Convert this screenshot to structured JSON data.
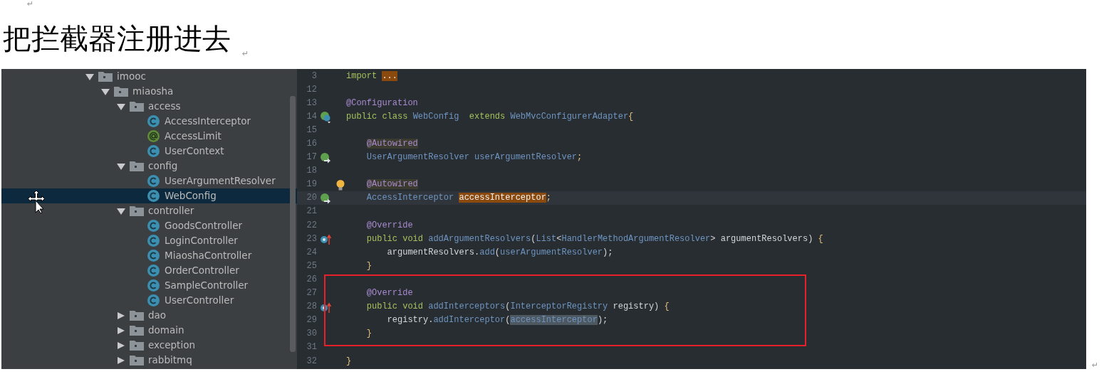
{
  "top_mark": "↵",
  "heading": {
    "text": "把拦截器注册进去",
    "mark": "↵"
  },
  "screenshot": {
    "project_tree": [
      {
        "label": "imooc",
        "kind": "folder",
        "expanded": true,
        "selected": false,
        "children": [
          {
            "label": "miaosha",
            "kind": "folder",
            "expanded": true,
            "selected": false,
            "children": [
              {
                "label": "access",
                "kind": "folder",
                "expanded": true,
                "selected": false,
                "children": [
                  {
                    "label": "AccessInterceptor",
                    "kind": "class",
                    "selected": false
                  },
                  {
                    "label": "AccessLimit",
                    "kind": "annotation",
                    "selected": false
                  },
                  {
                    "label": "UserContext",
                    "kind": "class",
                    "selected": false
                  }
                ]
              },
              {
                "label": "config",
                "kind": "folder",
                "expanded": true,
                "selected": false,
                "children": [
                  {
                    "label": "UserArgumentResolver",
                    "kind": "class",
                    "selected": false
                  },
                  {
                    "label": "WebConfig",
                    "kind": "class",
                    "selected": true
                  }
                ]
              },
              {
                "label": "controller",
                "kind": "folder",
                "expanded": true,
                "selected": false,
                "children": [
                  {
                    "label": "GoodsController",
                    "kind": "class",
                    "selected": false
                  },
                  {
                    "label": "LoginController",
                    "kind": "class",
                    "selected": false
                  },
                  {
                    "label": "MiaoshaController",
                    "kind": "class",
                    "selected": false
                  },
                  {
                    "label": "OrderController",
                    "kind": "class",
                    "selected": false
                  },
                  {
                    "label": "SampleController",
                    "kind": "class",
                    "selected": false
                  },
                  {
                    "label": "UserController",
                    "kind": "class",
                    "selected": false
                  }
                ]
              },
              {
                "label": "dao",
                "kind": "folder",
                "expanded": false,
                "selected": false
              },
              {
                "label": "domain",
                "kind": "folder",
                "expanded": false,
                "selected": false
              },
              {
                "label": "exception",
                "kind": "folder",
                "expanded": false,
                "selected": false
              },
              {
                "label": "rabbitmq",
                "kind": "folder",
                "expanded": false,
                "selected": false
              }
            ]
          }
        ]
      }
    ],
    "editor": {
      "lines": [
        {
          "number": "3",
          "tokens": [
            {
              "text": "import ",
              "kind": "keyword"
            },
            {
              "text": "...",
              "kind": "plain",
              "highlight": {
                "kind": "folded"
              }
            }
          ]
        },
        {
          "number": "12"
        },
        {
          "number": "13",
          "tokens": [
            {
              "text": "@Configuration",
              "kind": "annotation"
            }
          ]
        },
        {
          "number": "14",
          "marker": {
            "kind": "bean"
          },
          "tokens": [
            {
              "text": "public class ",
              "kind": "keyword"
            },
            {
              "text": "WebConfig  ",
              "kind": "type"
            },
            {
              "text": "extends ",
              "kind": "keyword"
            },
            {
              "text": "WebMvcConfigurerAdapter",
              "kind": "type"
            },
            {
              "text": "{",
              "kind": "brace"
            }
          ]
        },
        {
          "number": "15"
        },
        {
          "number": "16",
          "tokens": [
            {
              "text": "    @Autowired",
              "kind": "annotation",
              "highlight": {
                "kind": "annotation"
              }
            }
          ]
        },
        {
          "number": "17",
          "marker": {
            "kind": "injection"
          },
          "tokens": [
            {
              "text": "    UserArgumentResolver ",
              "kind": "type"
            },
            {
              "text": "userArgumentResolver",
              "kind": "field"
            },
            {
              "text": ";",
              "kind": "brace"
            }
          ]
        },
        {
          "number": "18"
        },
        {
          "number": "19",
          "marker": {
            "kind": "bulb"
          },
          "tokens": [
            {
              "text": "    @Autowired",
              "kind": "annotation",
              "highlight": {
                "kind": "annotation"
              }
            }
          ]
        },
        {
          "number": "20",
          "current": true,
          "marker": {
            "kind": "injection"
          },
          "tokens": [
            {
              "text": "    AccessInterceptor ",
              "kind": "type"
            },
            {
              "text": "accessInterceptor",
              "kind": "plain",
              "highlight": {
                "kind": "selection"
              }
            },
            {
              "text": ";",
              "kind": "brace"
            }
          ]
        },
        {
          "number": "21"
        },
        {
          "number": "22",
          "tokens": [
            {
              "text": "    @Override",
              "kind": "annotation"
            }
          ]
        },
        {
          "number": "23",
          "marker": {
            "kind": "override"
          },
          "tokens": [
            {
              "text": "    public void ",
              "kind": "keyword"
            },
            {
              "text": "addArgumentResolvers",
              "kind": "method"
            },
            {
              "text": "(",
              "kind": "punct"
            },
            {
              "text": "List",
              "kind": "type"
            },
            {
              "text": "<",
              "kind": "punct"
            },
            {
              "text": "HandlerMethodArgumentResolver",
              "kind": "type"
            },
            {
              "text": "> ",
              "kind": "punct"
            },
            {
              "text": "argumentResolvers",
              "kind": "plain"
            },
            {
              "text": ") ",
              "kind": "punct"
            },
            {
              "text": "{",
              "kind": "brace"
            }
          ]
        },
        {
          "number": "24",
          "tokens": [
            {
              "text": "        argumentResolvers.",
              "kind": "plain"
            },
            {
              "text": "add",
              "kind": "method"
            },
            {
              "text": "(",
              "kind": "punct"
            },
            {
              "text": "userArgumentResolver",
              "kind": "field"
            },
            {
              "text": ");",
              "kind": "punct"
            }
          ]
        },
        {
          "number": "25",
          "tokens": [
            {
              "text": "    }",
              "kind": "brace"
            }
          ]
        },
        {
          "number": "26"
        },
        {
          "number": "27",
          "tokens": [
            {
              "text": "    @Override",
              "kind": "annotation"
            }
          ]
        },
        {
          "number": "28",
          "marker": {
            "kind": "override"
          },
          "tokens": [
            {
              "text": "    public void ",
              "kind": "keyword"
            },
            {
              "text": "addInterceptors",
              "kind": "method"
            },
            {
              "text": "(",
              "kind": "punct"
            },
            {
              "text": "InterceptorRegistry ",
              "kind": "type"
            },
            {
              "text": "registry",
              "kind": "plain"
            },
            {
              "text": ") ",
              "kind": "punct"
            },
            {
              "text": "{",
              "kind": "brace"
            }
          ]
        },
        {
          "number": "29",
          "tokens": [
            {
              "text": "        registry.",
              "kind": "plain"
            },
            {
              "text": "addInterceptor",
              "kind": "method"
            },
            {
              "text": "(",
              "kind": "punct"
            },
            {
              "text": "accessInterceptor",
              "kind": "field",
              "highlight": {
                "kind": "usage"
              }
            },
            {
              "text": ");",
              "kind": "punct"
            }
          ]
        },
        {
          "number": "30",
          "tokens": [
            {
              "text": "    }",
              "kind": "brace"
            }
          ]
        },
        {
          "number": "31"
        },
        {
          "number": "32",
          "tokens": [
            {
              "text": "}",
              "kind": "brace"
            }
          ]
        }
      ]
    },
    "end_mark": "↵"
  }
}
